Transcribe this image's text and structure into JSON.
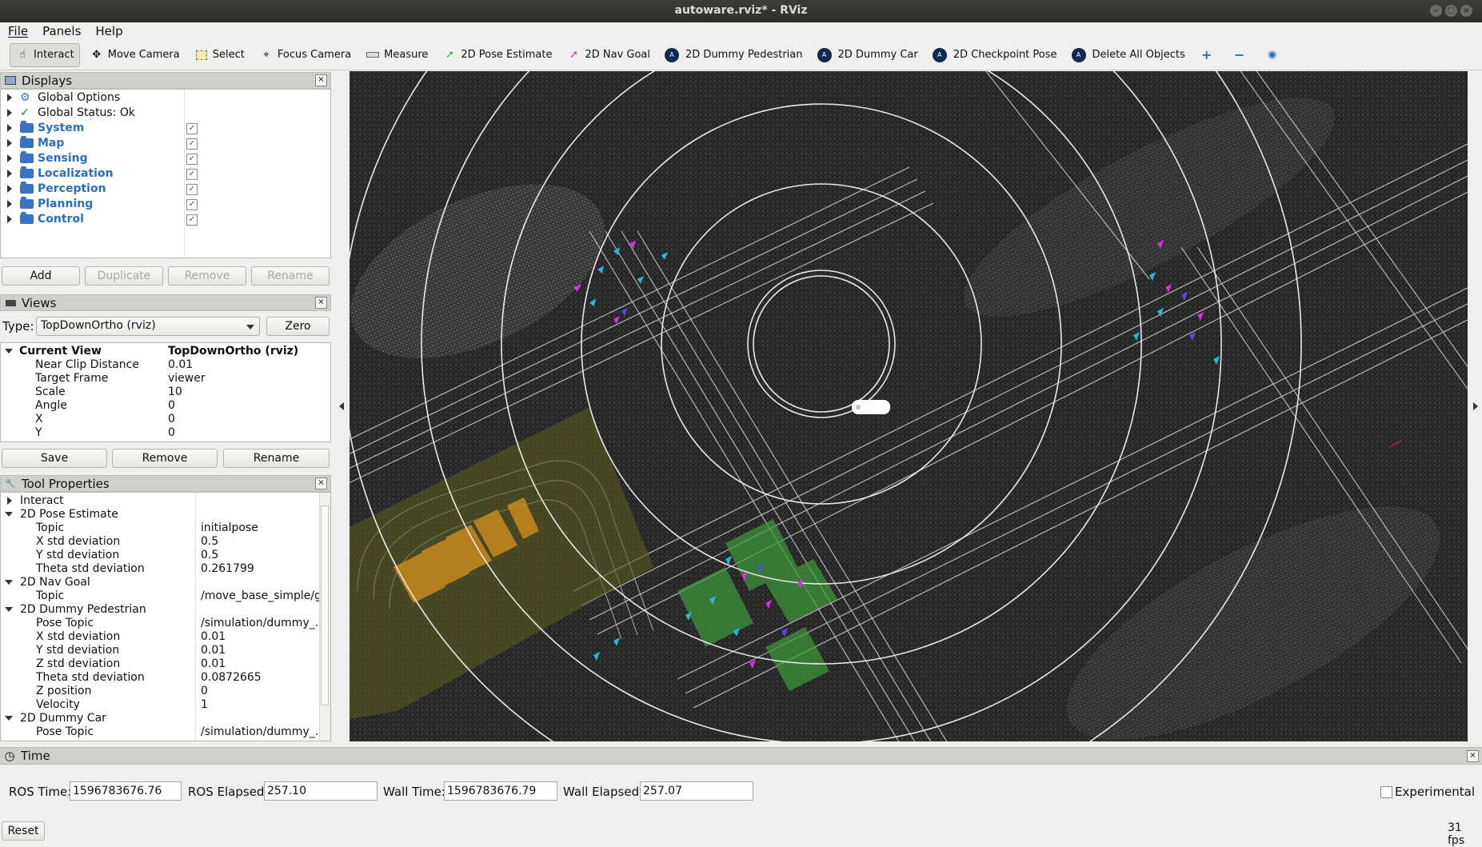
{
  "window": {
    "title": "autoware.rviz* - RViz"
  },
  "menu": [
    "File",
    "Panels",
    "Help"
  ],
  "toolbar": {
    "tools": [
      {
        "label": "Interact",
        "icon": "hand-icon",
        "active": true
      },
      {
        "label": "Move Camera",
        "icon": "move-camera-icon"
      },
      {
        "label": "Select",
        "icon": "select-icon"
      },
      {
        "label": "Focus Camera",
        "icon": "focus-camera-icon"
      },
      {
        "label": "Measure",
        "icon": "measure-icon"
      },
      {
        "label": "2D Pose Estimate",
        "icon": "green-arrow-icon"
      },
      {
        "label": "2D Nav Goal",
        "icon": "magenta-arrow-icon"
      },
      {
        "label": "2D Dummy Pedestrian",
        "icon": "autoware-icon"
      },
      {
        "label": "2D Dummy Car",
        "icon": "autoware-icon"
      },
      {
        "label": "2D Checkpoint Pose",
        "icon": "autoware-icon"
      },
      {
        "label": "Delete All Objects",
        "icon": "autoware-icon"
      }
    ]
  },
  "displays": {
    "title": "Displays",
    "items": [
      {
        "label": "Global Options",
        "kind": "gear"
      },
      {
        "label": "Global Status: Ok",
        "kind": "check"
      },
      {
        "label": "System",
        "kind": "folder",
        "checked": true
      },
      {
        "label": "Map",
        "kind": "folder",
        "checked": true
      },
      {
        "label": "Sensing",
        "kind": "folder",
        "checked": true
      },
      {
        "label": "Localization",
        "kind": "folder",
        "checked": true
      },
      {
        "label": "Perception",
        "kind": "folder",
        "checked": true
      },
      {
        "label": "Planning",
        "kind": "folder",
        "checked": true
      },
      {
        "label": "Control",
        "kind": "folder",
        "checked": true
      }
    ],
    "buttons": {
      "add": "Add",
      "duplicate": "Duplicate",
      "remove": "Remove",
      "rename": "Rename"
    }
  },
  "views": {
    "title": "Views",
    "type_label": "Type:",
    "type_value": "TopDownOrtho (rviz)",
    "zero": "Zero",
    "current_view": {
      "label": "Current View",
      "value": "TopDownOrtho (rviz)"
    },
    "props": [
      {
        "name": "Near Clip Distance",
        "value": "0.01"
      },
      {
        "name": "Target Frame",
        "value": "viewer"
      },
      {
        "name": "Scale",
        "value": "10"
      },
      {
        "name": "Angle",
        "value": "0"
      },
      {
        "name": "X",
        "value": "0"
      },
      {
        "name": "Y",
        "value": "0"
      }
    ],
    "buttons": {
      "save": "Save",
      "remove": "Remove",
      "rename": "Rename"
    }
  },
  "tool_properties": {
    "title": "Tool Properties",
    "rows": [
      {
        "name": "Interact",
        "value": "",
        "level": 0,
        "expand": "right"
      },
      {
        "name": "2D Pose Estimate",
        "value": "",
        "level": 0,
        "expand": "down"
      },
      {
        "name": "Topic",
        "value": "initialpose",
        "level": 1
      },
      {
        "name": "X std deviation",
        "value": "0.5",
        "level": 1
      },
      {
        "name": "Y std deviation",
        "value": "0.5",
        "level": 1
      },
      {
        "name": "Theta std deviation",
        "value": "0.261799",
        "level": 1
      },
      {
        "name": "2D Nav Goal",
        "value": "",
        "level": 0,
        "expand": "down"
      },
      {
        "name": "Topic",
        "value": "/move_base_simple/g...",
        "level": 1
      },
      {
        "name": "2D Dummy Pedestrian",
        "value": "",
        "level": 0,
        "expand": "down"
      },
      {
        "name": "Pose Topic",
        "value": "/simulation/dummy_...",
        "level": 1
      },
      {
        "name": "X std deviation",
        "value": "0.01",
        "level": 1
      },
      {
        "name": "Y std deviation",
        "value": "0.01",
        "level": 1
      },
      {
        "name": "Z std deviation",
        "value": "0.01",
        "level": 1
      },
      {
        "name": "Theta std deviation",
        "value": "0.0872665",
        "level": 1
      },
      {
        "name": "Z position",
        "value": "0",
        "level": 1
      },
      {
        "name": "Velocity",
        "value": "1",
        "level": 1
      },
      {
        "name": "2D Dummy Car",
        "value": "",
        "level": 0,
        "expand": "down"
      },
      {
        "name": "Pose Topic",
        "value": "/simulation/dummy_...",
        "level": 1
      }
    ]
  },
  "time": {
    "title": "Time",
    "ros_time_label": "ROS Time:",
    "ros_time": "1596783676.76",
    "ros_elapsed_label": "ROS Elapsed:",
    "ros_elapsed": "257.10",
    "wall_time_label": "Wall Time:",
    "wall_time": "1596783676.79",
    "wall_elapsed_label": "Wall Elapsed:",
    "wall_elapsed": "257.07",
    "experimental": "Experimental",
    "reset": "Reset",
    "fps": "31 fps"
  },
  "colors": {
    "accent_folder": "#3a73c4",
    "category_text": "#2a6fbf",
    "viewport_bg": "#1f1f1f"
  }
}
